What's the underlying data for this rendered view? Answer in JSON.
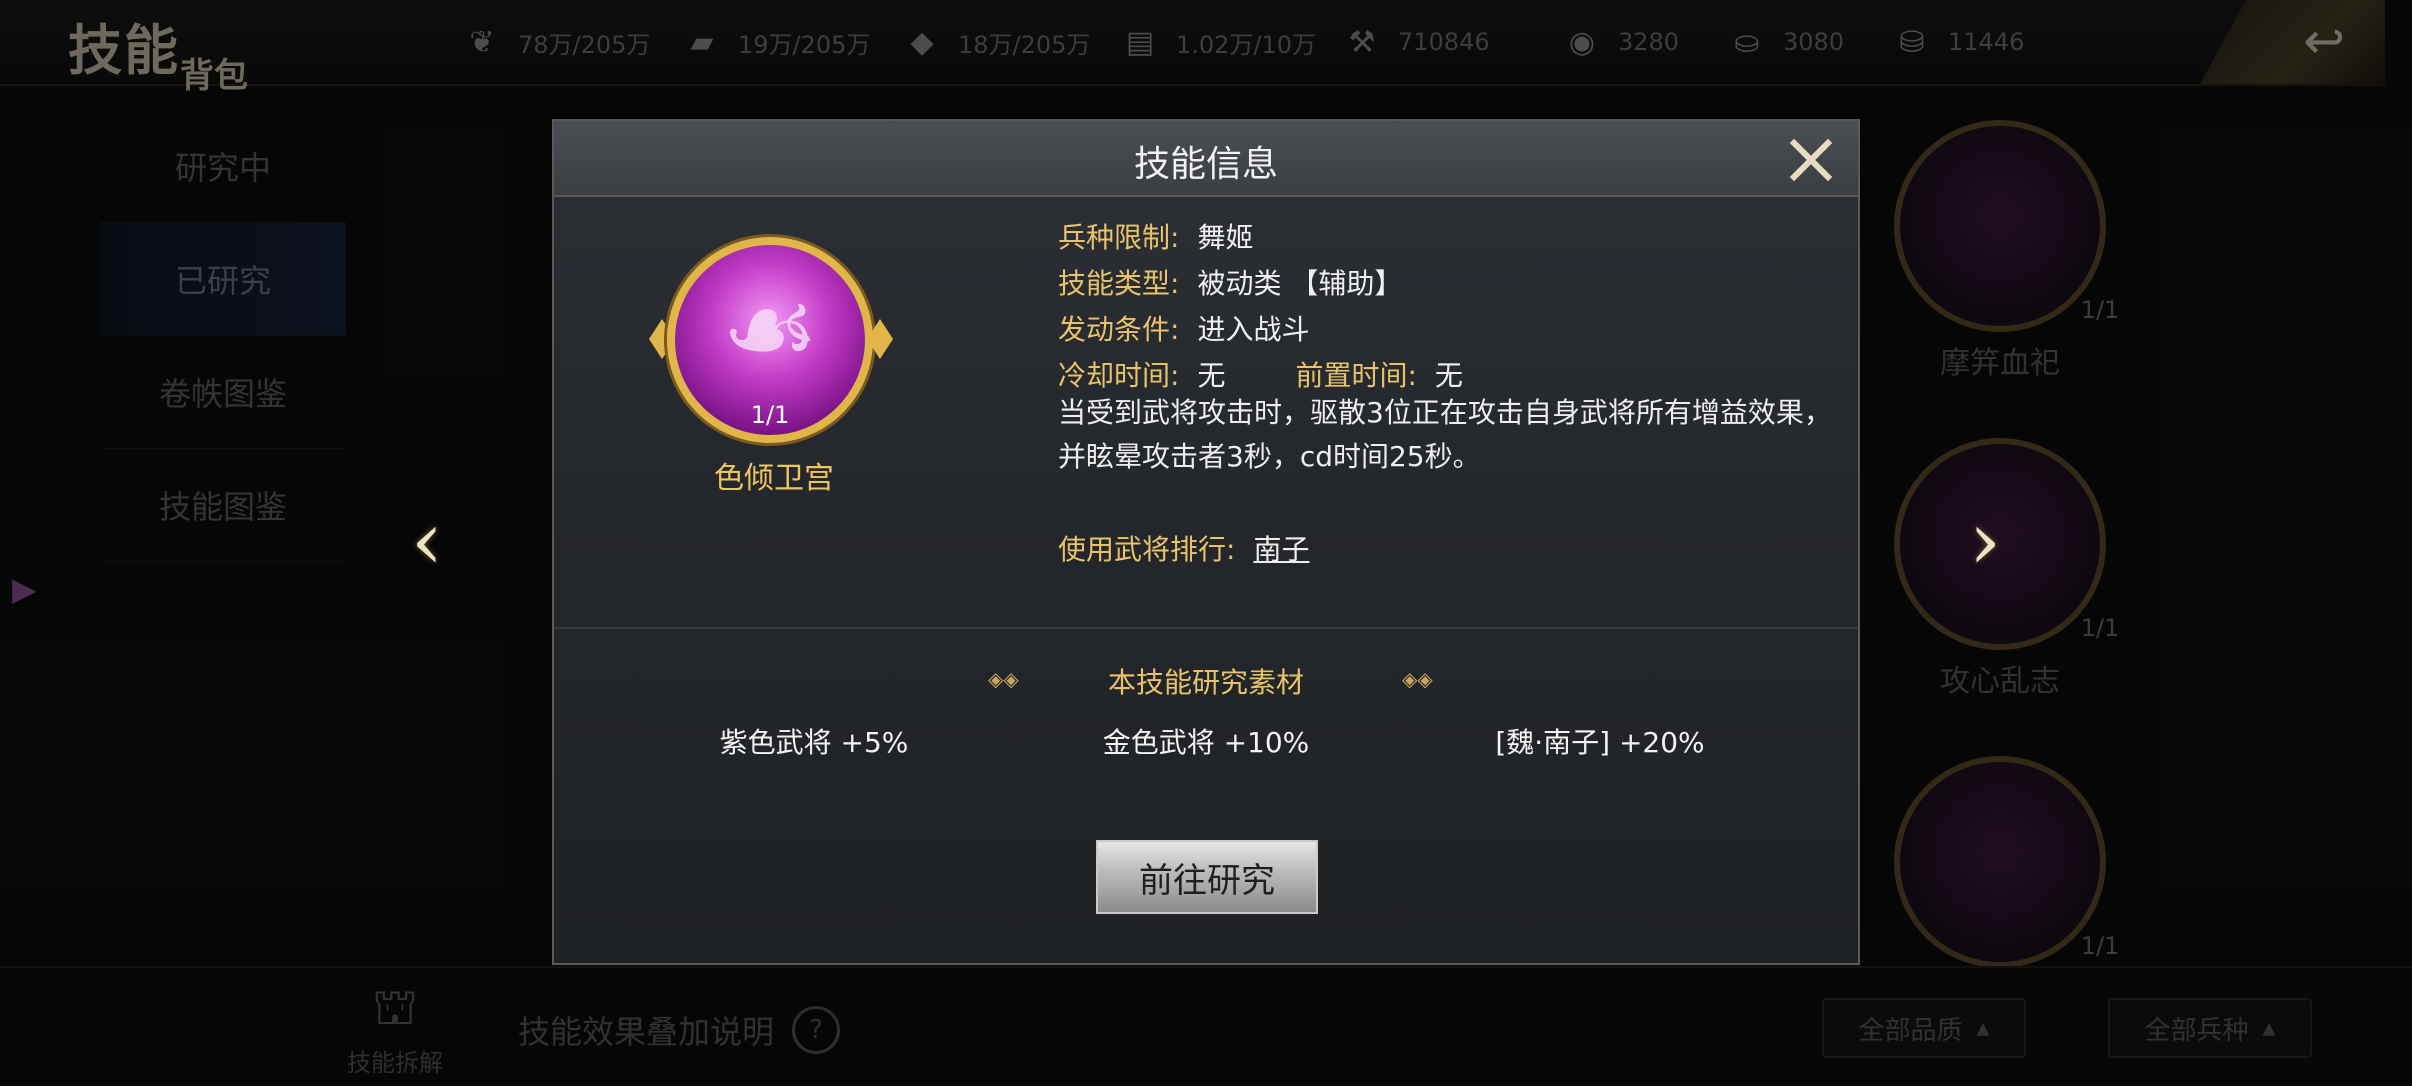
{
  "header": {
    "title_main": "技能",
    "title_sub": "背包",
    "resources": [
      {
        "icon": "wheat-icon",
        "value": "78万/205万"
      },
      {
        "icon": "wood-icon",
        "value": "19万/205万"
      },
      {
        "icon": "stone-icon",
        "value": "18万/205万"
      },
      {
        "icon": "iron-icon",
        "value": "1.02万/10万"
      },
      {
        "icon": "scroll-icon",
        "value": "710846"
      },
      {
        "icon": "coin-icon",
        "value": "3280"
      },
      {
        "icon": "ingot-icon",
        "value": "3080"
      },
      {
        "icon": "gold-ingot-icon",
        "value": "11446"
      }
    ]
  },
  "tabs": [
    {
      "label": "研究中"
    },
    {
      "label": "已研究"
    },
    {
      "label": "卷帙图鉴"
    },
    {
      "label": "技能图鉴"
    }
  ],
  "right_skills": [
    {
      "level": "1/1",
      "name": "摩笄血祀"
    },
    {
      "level": "1/1",
      "name": "攻心乱志"
    },
    {
      "level": "1/1",
      "name": ""
    }
  ],
  "bottom": {
    "decompose_label": "技能拆解",
    "effect_note": "技能效果叠加说明",
    "filter_quality": "全部品质",
    "filter_troop": "全部兵种"
  },
  "modal": {
    "title": "技能信息",
    "skill": {
      "name": "色倾卫宫",
      "level": "1/1"
    },
    "troop_limit_label": "兵种限制:",
    "troop_limit_value": "舞姬",
    "skill_type_label": "技能类型:",
    "skill_type_value": "被动类 【辅助】",
    "trigger_label": "发动条件:",
    "trigger_value": "进入战斗",
    "cooldown_label": "冷却时间:",
    "cooldown_value": "无",
    "prep_label": "前置时间:",
    "prep_value": "无",
    "description": "当受到武将攻击时，驱散3位正在攻击自身武将所有增益效果，并眩晕攻击者3秒，cd时间25秒。",
    "rank_label": "使用武将排行:",
    "rank_value": "南子",
    "materials_title": "本技能研究素材",
    "materials": [
      "紫色武将 +5%",
      "金色武将 +10%",
      "[魏·南子] +20%"
    ],
    "go_button": "前往研究"
  }
}
